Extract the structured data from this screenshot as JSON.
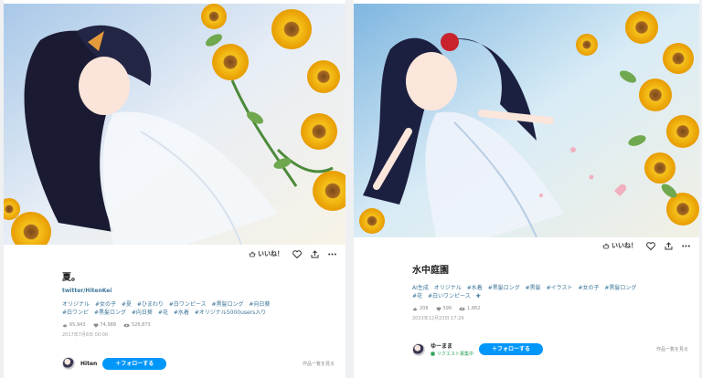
{
  "left": {
    "actions": {
      "like_label": "いいね！"
    },
    "title": "夏。",
    "sub_link": "twitter/HitenKei",
    "tags": [
      "オリジナル",
      "#女の子",
      "#夏",
      "#ひまわり",
      "#白ワンピース",
      "#黒髪ロング",
      "#向日葵",
      "#白ワンピ",
      "#黒髪ロング",
      "#向日葵",
      "#花",
      "#水着",
      "#オリジナル5000users入り"
    ],
    "stats": {
      "likes": "65,943",
      "bookmarks": "74,988",
      "views": "526,873"
    },
    "date": "2017年7月8日 00:00",
    "author": {
      "name": "Hiten"
    },
    "follow_label": "＋フォローする",
    "see_all_label": "作品一覧を見る"
  },
  "right": {
    "actions": {
      "like_label": "いいね！"
    },
    "title": "水中庭園",
    "tags": [
      "AI生成",
      "オリジナル",
      "#水着",
      "#黒髪ロング",
      "#黒髪",
      "#イラスト",
      "#女の子",
      "#黒髪ロング",
      "#花",
      "#白いワンピース",
      "✚"
    ],
    "stats": {
      "likes": "208",
      "bookmarks": "599",
      "views": "1,862"
    },
    "date": "2023年12月23日 17:29",
    "author": {
      "name": "ゆーまま",
      "badge": "リクエスト募集中"
    },
    "follow_label": "＋フォローする",
    "see_all_label": "作品一覧を見る"
  },
  "colors": {
    "accent": "#0096fa",
    "tag": "#3d7699",
    "sunflower": "#f4b400"
  },
  "icons": [
    "heart-icon",
    "share-icon",
    "more-icon",
    "like-icon",
    "bookmark-icon",
    "eye-icon"
  ]
}
